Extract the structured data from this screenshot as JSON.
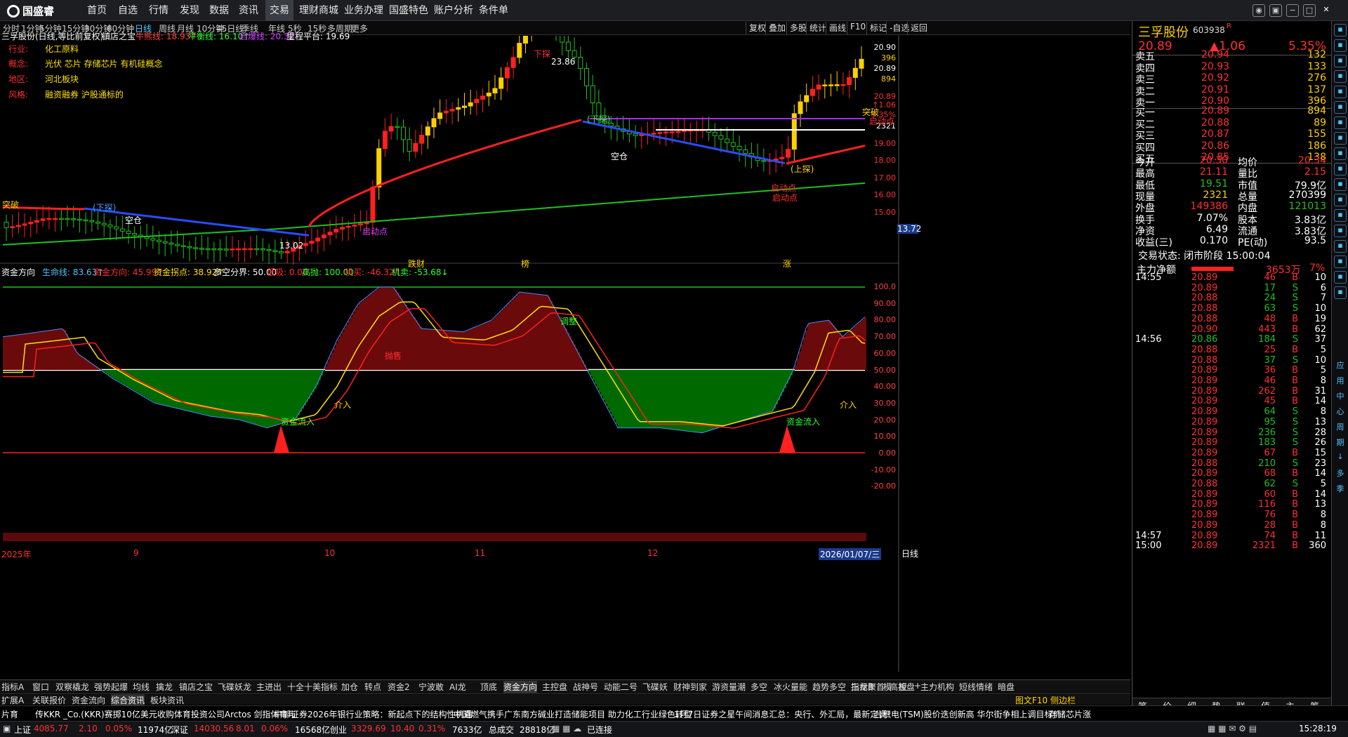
{
  "app": {
    "name": "国盛睿"
  },
  "menu": [
    "首页",
    "自选",
    "行情",
    "发现",
    "数据",
    "资讯",
    "交易",
    "理财商城",
    "业务办理",
    "国盛特色",
    "账户分析",
    "条件单"
  ],
  "active_menu": "交易",
  "timeframes": [
    "分时",
    "1分钟",
    "5分钟",
    "15分钟",
    "30分钟",
    "60分钟",
    "日线",
    "周线",
    "月线",
    "10分钟",
    "45日线",
    "季线",
    "年线",
    "5秒",
    "15秒",
    "多周期",
    "更多"
  ],
  "active_timeframe": "日线",
  "right_tools": [
    "复权",
    "叠加",
    "多股",
    "统计",
    "画线",
    "F10",
    "标记",
    "-自选",
    "返回"
  ],
  "chart_header": {
    "title": "三孚股份(日线,等比前复权)",
    "indicator": "镇店之宝",
    "l1": "牛熊线: 18.93↑",
    "l2": "平衡线: 16.10↑",
    "l3": "启爆线: 20.32",
    "l4": "里程平台: 19.69"
  },
  "info": {
    "k1": "行业:",
    "v1": "化工原料",
    "k2": "概念:",
    "v2": "光伏 芯片 存储芯片 有机硅概念",
    "k3": "地区:",
    "v3": "河北板块",
    "k4": "风格:",
    "v4": "融资融券 沪股通标的"
  },
  "price_axis": [
    "20.90",
    "396",
    "20.89",
    "894",
    "20.89",
    "↑1.06",
    "5.35%",
    "2321",
    "19.00",
    "18.00",
    "17.00",
    "16.00",
    "15.00"
  ],
  "price_tag": "13.72",
  "annotations": {
    "high": "23.86",
    "low": "13.02",
    "a1": "突破",
    "a2": "(下探)",
    "a3": "空仓",
    "a4": "下探",
    "a5": "(下探)",
    "a6": "空仓",
    "a7": "启动点",
    "a8": "启动点",
    "a9": "突破",
    "a10": "启动点",
    "a11": "跌财",
    "a12": "榜",
    "a13": "涨",
    "a14": "(上探)",
    "a15": "启动点"
  },
  "sub_header": {
    "name": "资金方向",
    "l1": "生命线: 83.63↑",
    "l2": "资金方向: 45.99↑",
    "l3": "资金拐点: 38.92↑",
    "l4": "多空分界: 50.00",
    "l5": "低吸: 0.00",
    "l6": "高抛: 100.00",
    "l7": "机买: -46.32↑",
    "l8": "机卖: -53.68↓"
  },
  "sub_axis": [
    "100.0",
    "90.00",
    "80.00",
    "70.00",
    "60.00",
    "50.00",
    "40.00",
    "30.00",
    "20.00",
    "10.00",
    "0.00",
    "-10.00",
    "-20.00"
  ],
  "sub_annot": {
    "s1": "资金流入",
    "s2": "介入",
    "s3": "抛售",
    "s4": "调整",
    "s5": "资金流入",
    "s6": "介入"
  },
  "date_axis": {
    "d1": "2025年",
    "d2": "9",
    "d3": "10",
    "d4": "11",
    "d5": "12",
    "d6": "2026/01/07/三",
    "btn": "日线"
  },
  "tabs": [
    "指标A",
    "窗口",
    "双察橇龙",
    "强势起爆",
    "均线",
    "擒龙",
    "镇店之宝",
    "飞碟妖龙",
    "主进出",
    "十全十美指标",
    "加仓",
    "转点",
    "资金2",
    "宁波敢",
    "AI龙",
    "顶底",
    "资金方向",
    "主控盘",
    "战神号",
    "动能二号",
    "飞碟妖",
    "财神到家",
    "游资量潮",
    "多空",
    "冰火量能",
    "趋势多空",
    "三龙聚首",
    "高控盘",
    "主力机构",
    "短线情绪",
    "暗盘"
  ],
  "tabs_right": [
    "指标B",
    "模",
    "板",
    "+",
    "-"
  ],
  "tabs2": [
    "扩展A",
    "关联报价",
    "资金流向",
    "综合资讯",
    "板块资讯"
  ],
  "tabs2_right": "图文F10 侧边栏",
  "stock": {
    "name": "三孚股份",
    "code": "603938",
    "flag": "R",
    "price": "20.89",
    "chg": "▲1.06",
    "pct": "5.35%"
  },
  "asks": [
    {
      "l": "卖五",
      "p": "20.94",
      "v": "132"
    },
    {
      "l": "卖四",
      "p": "20.93",
      "v": "133"
    },
    {
      "l": "卖三",
      "p": "20.92",
      "v": "276"
    },
    {
      "l": "卖二",
      "p": "20.91",
      "v": "137"
    },
    {
      "l": "卖一",
      "p": "20.90",
      "v": "396"
    }
  ],
  "bids": [
    {
      "l": "买一",
      "p": "20.89",
      "v": "894"
    },
    {
      "l": "买二",
      "p": "20.88",
      "v": "89"
    },
    {
      "l": "买三",
      "p": "20.87",
      "v": "155"
    },
    {
      "l": "买四",
      "p": "20.86",
      "v": "186"
    },
    {
      "l": "买五",
      "p": "20.85",
      "v": "138"
    }
  ],
  "stats": [
    {
      "k1": "今开",
      "v1": "20.30",
      "k2": "均价",
      "v2": "20.34"
    },
    {
      "k1": "最高",
      "v1": "21.11",
      "k2": "量比",
      "v2": "2.15"
    },
    {
      "k1": "最低",
      "v1": "19.51",
      "k2": "市值",
      "v2": "79.9亿"
    },
    {
      "k1": "现量",
      "v1": "2321",
      "k2": "总量",
      "v2": "270399"
    },
    {
      "k1": "外盘",
      "v1": "149386",
      "k2": "内盘",
      "v2": "121013"
    },
    {
      "k1": "换手",
      "v1": "7.07%",
      "k2": "股本",
      "v2": "3.83亿"
    },
    {
      "k1": "净资",
      "v1": "6.49",
      "k2": "流通",
      "v2": "3.83亿"
    },
    {
      "k1": "收益(三)",
      "v1": "0.170",
      "k2": "PE(动)",
      "v2": "93.5"
    }
  ],
  "trade_state": "交易状态: 闭市阶段 15:00:04",
  "net": {
    "label": "主力净额",
    "value": "3653万",
    "pct": "7%"
  },
  "ticks": [
    {
      "t": "14:55",
      "p": "20.89",
      "v": "46",
      "d": "B",
      "n": "10"
    },
    {
      "t": "",
      "p": "20.89",
      "v": "17",
      "d": "S",
      "n": "6"
    },
    {
      "t": "",
      "p": "20.88",
      "v": "24",
      "d": "S",
      "n": "7"
    },
    {
      "t": "",
      "p": "20.88",
      "v": "63",
      "d": "S",
      "n": "10"
    },
    {
      "t": "",
      "p": "20.88",
      "v": "48",
      "d": "B",
      "n": "19"
    },
    {
      "t": "",
      "p": "20.90",
      "v": "443",
      "d": "B",
      "n": "62"
    },
    {
      "t": "14:56",
      "p": "20.86",
      "v": "184",
      "d": "S",
      "n": "37"
    },
    {
      "t": "",
      "p": "20.88",
      "v": "25",
      "d": "B",
      "n": "5"
    },
    {
      "t": "",
      "p": "20.88",
      "v": "37",
      "d": "S",
      "n": "10"
    },
    {
      "t": "",
      "p": "20.89",
      "v": "36",
      "d": "B",
      "n": "5"
    },
    {
      "t": "",
      "p": "20.89",
      "v": "46",
      "d": "B",
      "n": "8"
    },
    {
      "t": "",
      "p": "20.89",
      "v": "262",
      "d": "B",
      "n": "31"
    },
    {
      "t": "",
      "p": "20.89",
      "v": "45",
      "d": "B",
      "n": "14"
    },
    {
      "t": "",
      "p": "20.89",
      "v": "64",
      "d": "S",
      "n": "8"
    },
    {
      "t": "",
      "p": "20.89",
      "v": "95",
      "d": "S",
      "n": "13"
    },
    {
      "t": "",
      "p": "20.89",
      "v": "236",
      "d": "S",
      "n": "28"
    },
    {
      "t": "",
      "p": "20.89",
      "v": "183",
      "d": "S",
      "n": "26"
    },
    {
      "t": "",
      "p": "20.89",
      "v": "67",
      "d": "B",
      "n": "15"
    },
    {
      "t": "",
      "p": "20.88",
      "v": "210",
      "d": "S",
      "n": "23"
    },
    {
      "t": "",
      "p": "20.89",
      "v": "68",
      "d": "B",
      "n": "14"
    },
    {
      "t": "",
      "p": "20.88",
      "v": "62",
      "d": "S",
      "n": "5"
    },
    {
      "t": "",
      "p": "20.89",
      "v": "60",
      "d": "B",
      "n": "14"
    },
    {
      "t": "",
      "p": "20.89",
      "v": "116",
      "d": "B",
      "n": "13"
    },
    {
      "t": "",
      "p": "20.89",
      "v": "76",
      "d": "B",
      "n": "8"
    },
    {
      "t": "",
      "p": "20.89",
      "v": "28",
      "d": "B",
      "n": "8"
    },
    {
      "t": "14:57",
      "p": "20.89",
      "v": "74",
      "d": "B",
      "n": "11"
    },
    {
      "t": "15:00",
      "p": "20.89",
      "v": "2321",
      "d": "B",
      "n": "360"
    }
  ],
  "rtabs": [
    "笔",
    "价",
    "细",
    "势",
    "联",
    "值",
    "主",
    "筹"
  ],
  "sidebar": [
    "应",
    "用",
    "中",
    "心",
    "周",
    "期",
    "↓",
    "多",
    "季"
  ],
  "news": [
    "片育",
    "传KKR _Co.(KKR)赛掷10亿美元收购体育投资公司Arctos 剑指体育与",
    "中邮证券2026年银行业策略：新起点下的结构性机遇",
    "中国燃气携手广东南方碱业打造储能项目 助力化工行业绿色转型",
    "1月7日证券之星午间消息汇总：央行、外汇局，最新定调!",
    "台积电(TSM)股价迭创新高 华尔街争相上调目标价",
    "存储芯片涨"
  ],
  "status": {
    "sh_l": "上证",
    "sh": "4085.77",
    "sh_c": "2.10",
    "sh_p": "0.05%",
    "sh_a": "11974亿",
    "sz_l": "深证",
    "sz": "14030.56",
    "sz_c": "8.01",
    "sz_p": "0.06%",
    "sz_a": "16568亿",
    "cy_l": "创业",
    "cy": "3329.69",
    "cy_c": "10.40",
    "cy_p": "0.31%",
    "cy_a": "7633亿",
    "zc_l": "总成交",
    "zc": "28818亿",
    "conn": "已连接",
    "time": "15:28:19"
  },
  "colors": {
    "up": "#ff3b3b",
    "down": "#00c000",
    "yellow": "#ffd000",
    "blue": "#2a4bff",
    "accent": "#4fc3ff"
  }
}
